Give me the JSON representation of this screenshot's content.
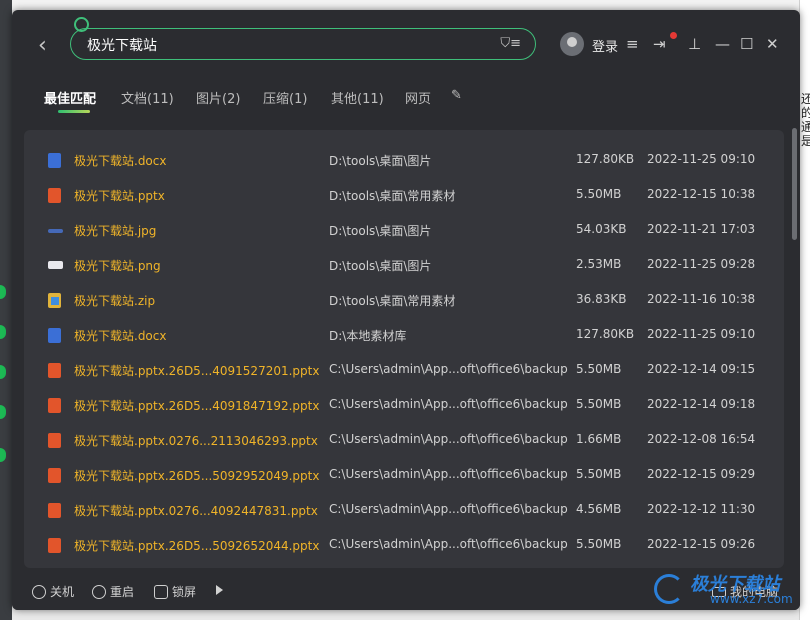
{
  "search": {
    "value": "极光下载站"
  },
  "header": {
    "login_label": "登录"
  },
  "tabs": [
    {
      "label": "最佳匹配"
    },
    {
      "label": "文档(11)"
    },
    {
      "label": "图片(2)"
    },
    {
      "label": "压缩(1)"
    },
    {
      "label": "其他(11)"
    },
    {
      "label": "网页"
    }
  ],
  "files": [
    {
      "name": "极光下载站.docx",
      "path": "D:\\tools\\桌面\\图片",
      "size": "127.80KB",
      "date": "2022-11-25 09:10",
      "icon": "word-icon"
    },
    {
      "name": "极光下载站.pptx",
      "path": "D:\\tools\\桌面\\常用素材",
      "size": "5.50MB",
      "date": "2022-12-15 10:38",
      "icon": "ppt-icon"
    },
    {
      "name": "极光下载站.jpg",
      "path": "D:\\tools\\桌面\\图片",
      "size": "54.03KB",
      "date": "2022-11-21 17:03",
      "icon": "jpg-icon"
    },
    {
      "name": "极光下载站.png",
      "path": "D:\\tools\\桌面\\图片",
      "size": "2.53MB",
      "date": "2022-11-25 09:28",
      "icon": "png-icon"
    },
    {
      "name": "极光下载站.zip",
      "path": "D:\\tools\\桌面\\常用素材",
      "size": "36.83KB",
      "date": "2022-11-16 10:38",
      "icon": "zip-icon"
    },
    {
      "name": "极光下载站.docx",
      "path": "D:\\本地素材库",
      "size": "127.80KB",
      "date": "2022-11-25 09:10",
      "icon": "word-icon"
    },
    {
      "name": "极光下载站.pptx.26D5...4091527201.pptx",
      "path": "C:\\Users\\admin\\App...oft\\office6\\backup",
      "size": "5.50MB",
      "date": "2022-12-14 09:15",
      "icon": "ppt-icon"
    },
    {
      "name": "极光下载站.pptx.26D5...4091847192.pptx",
      "path": "C:\\Users\\admin\\App...oft\\office6\\backup",
      "size": "5.50MB",
      "date": "2022-12-14 09:18",
      "icon": "ppt-icon"
    },
    {
      "name": "极光下载站.pptx.0276...2113046293.pptx",
      "path": "C:\\Users\\admin\\App...oft\\office6\\backup",
      "size": "1.66MB",
      "date": "2022-12-08 16:54",
      "icon": "ppt-icon"
    },
    {
      "name": "极光下载站.pptx.26D5...5092952049.pptx",
      "path": "C:\\Users\\admin\\App...oft\\office6\\backup",
      "size": "5.50MB",
      "date": "2022-12-15 09:29",
      "icon": "ppt-icon"
    },
    {
      "name": "极光下载站.pptx.0276...4092447831.pptx",
      "path": "C:\\Users\\admin\\App...oft\\office6\\backup",
      "size": "4.56MB",
      "date": "2022-12-12 11:30",
      "icon": "ppt-icon"
    },
    {
      "name": "极光下载站.pptx.26D5...5092652044.pptx",
      "path": "C:\\Users\\admin\\App...oft\\office6\\backup",
      "size": "5.50MB",
      "date": "2022-12-15 09:26",
      "icon": "ppt-icon"
    }
  ],
  "footer": {
    "shutdown_label": "关机",
    "restart_label": "重启",
    "lock_label": "锁屏",
    "mypc_label": "我的电脑"
  },
  "watermark": {
    "title": "极光下载站",
    "url": "www.xz7.com"
  },
  "background": {
    "right_edge_text": [
      "还",
      "的",
      "通",
      "是"
    ]
  },
  "colors": {
    "accent": "#3fbf7a",
    "filename": "#f0b429",
    "window_bg": "#2b2c30",
    "list_bg": "#35363b"
  }
}
